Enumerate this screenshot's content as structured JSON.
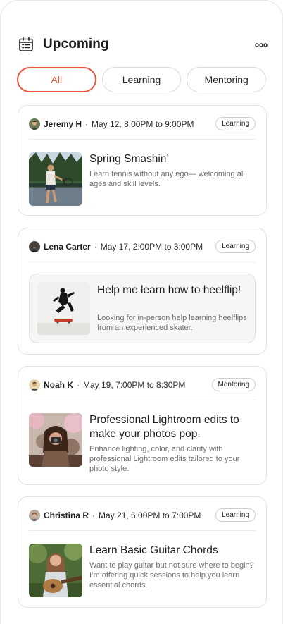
{
  "header": {
    "title": "Upcoming",
    "calendar_icon": "calendar-icon",
    "more_icon": "more-dots-icon"
  },
  "tabs": [
    {
      "label": "All",
      "active": true
    },
    {
      "label": "Learning",
      "active": false
    },
    {
      "label": "Mentoring",
      "active": false
    }
  ],
  "accent_color": "#e8553d",
  "sessions": [
    {
      "host": "Jeremy H",
      "when": "May 12, 8:00PM to 9:00PM",
      "category": "Learning",
      "title": "Spring Smashin’",
      "description": "Learn tennis without any ego— welcoming all ages and skill levels.",
      "thumbnail": "tennis-player-photo"
    },
    {
      "host": "Lena Carter",
      "when": "May 17, 2:00PM to 3:00PM",
      "category": "Learning",
      "title": "Help me learn how to heelflip!",
      "description": "Looking for in-person help learning heelflips from an experienced skater.",
      "thumbnail": "skateboard-jump-photo"
    },
    {
      "host": "Noah K",
      "when": "May 19, 7:00PM to 8:30PM",
      "category": "Mentoring",
      "title": "Professional Lightroom edits to make your photos pop.",
      "description": "Enhance lighting, color, and clarity with professional Lightroom edits tailored to your photo style.",
      "thumbnail": "photographer-photo"
    },
    {
      "host": "Christina R",
      "when": "May 21, 6:00PM to 7:00PM",
      "category": "Learning",
      "title": "Learn Basic Guitar Chords",
      "description": "Want to play guitar but not sure where to begin? I’m offering quick sessions to help you learn essential chords.",
      "thumbnail": "guitar-player-photo"
    }
  ]
}
